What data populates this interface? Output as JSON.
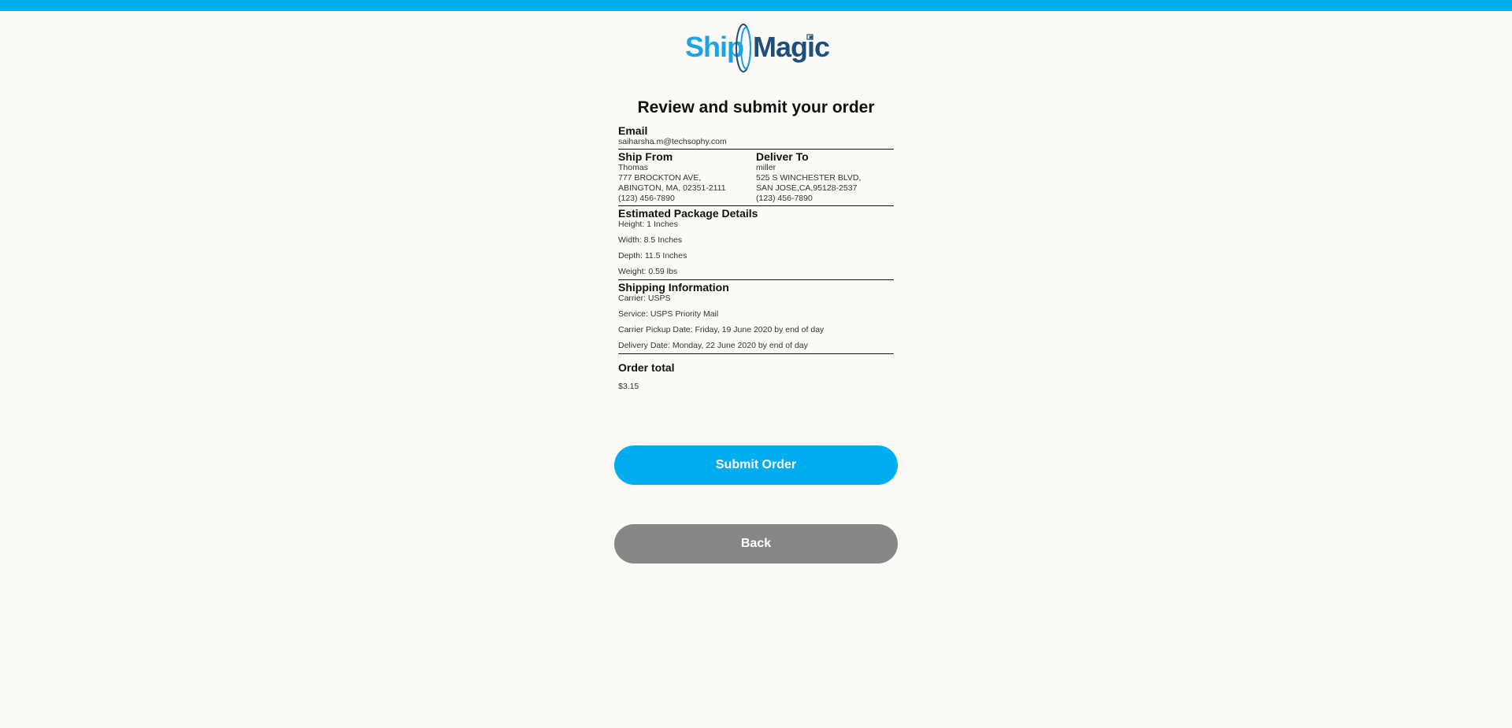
{
  "brand": {
    "logo_left": "Ship",
    "logo_right": "Magic",
    "accent_color": "#00aeef"
  },
  "page": {
    "title": "Review and submit your order"
  },
  "email": {
    "heading": "Email",
    "value": "saiharsha.m@techsophy.com"
  },
  "ship_from": {
    "heading": "Ship From",
    "name": "Thomas",
    "street": "777 BROCKTON AVE,",
    "city_line": "ABINGTON, MA, 02351-2111",
    "phone": "(123) 456-7890"
  },
  "deliver_to": {
    "heading": "Deliver To",
    "name": "miller",
    "street": "525 S WINCHESTER BLVD,",
    "city_line": "SAN JOSE,CA,95128-2537",
    "phone": "(123) 456-7890"
  },
  "package": {
    "heading": "Estimated Package Details",
    "lines": [
      "Height: 1 Inches",
      "Width: 8.5 Inches",
      "Depth: 11.5 Inches",
      "Weight: 0.59 lbs"
    ]
  },
  "shipping": {
    "heading": "Shipping Information",
    "lines": [
      "Carrier: USPS",
      "Service: USPS Priority Mail",
      "Carrier Pickup Date: Friday, 19 June 2020 by end of day",
      "Delivery Date: Monday, 22 June 2020 by end of day"
    ]
  },
  "order_total": {
    "heading": "Order total",
    "value": "$3.15"
  },
  "buttons": {
    "submit": "Submit Order",
    "back": "Back"
  }
}
